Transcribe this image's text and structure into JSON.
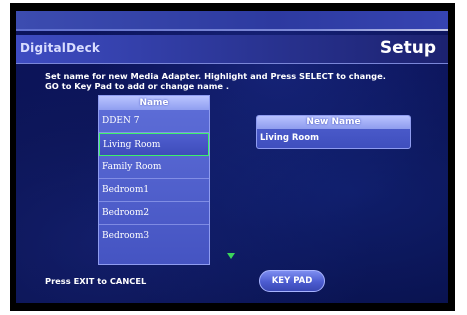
{
  "header": {
    "brand": "DigitalDeck",
    "title": "Setup"
  },
  "instructions": {
    "line1": "Set name for new Media Adapter. Highlight and Press SELECT to change.",
    "line2": "GO to Key Pad to add or change name ."
  },
  "name_list": {
    "header": "Name",
    "items": [
      {
        "label": "DDEN 7",
        "selected": false
      },
      {
        "label": "Living Room",
        "selected": true
      },
      {
        "label": "Family Room",
        "selected": false
      },
      {
        "label": "Bedroom1",
        "selected": false
      },
      {
        "label": "Bedroom2",
        "selected": false
      },
      {
        "label": "Bedroom3",
        "selected": false
      }
    ]
  },
  "new_name": {
    "header": "New Name",
    "value": "Living Room"
  },
  "footer": {
    "exit_hint": "Press EXIT to CANCEL",
    "keypad_label": "KEY PAD"
  },
  "icons": {
    "scroll_down": "scroll-down-arrow-icon"
  },
  "colors": {
    "background": "#0a1250",
    "panel": "#4554c2",
    "selection_outline": "#3df06a",
    "scroll_arrow": "#3bd45a"
  }
}
